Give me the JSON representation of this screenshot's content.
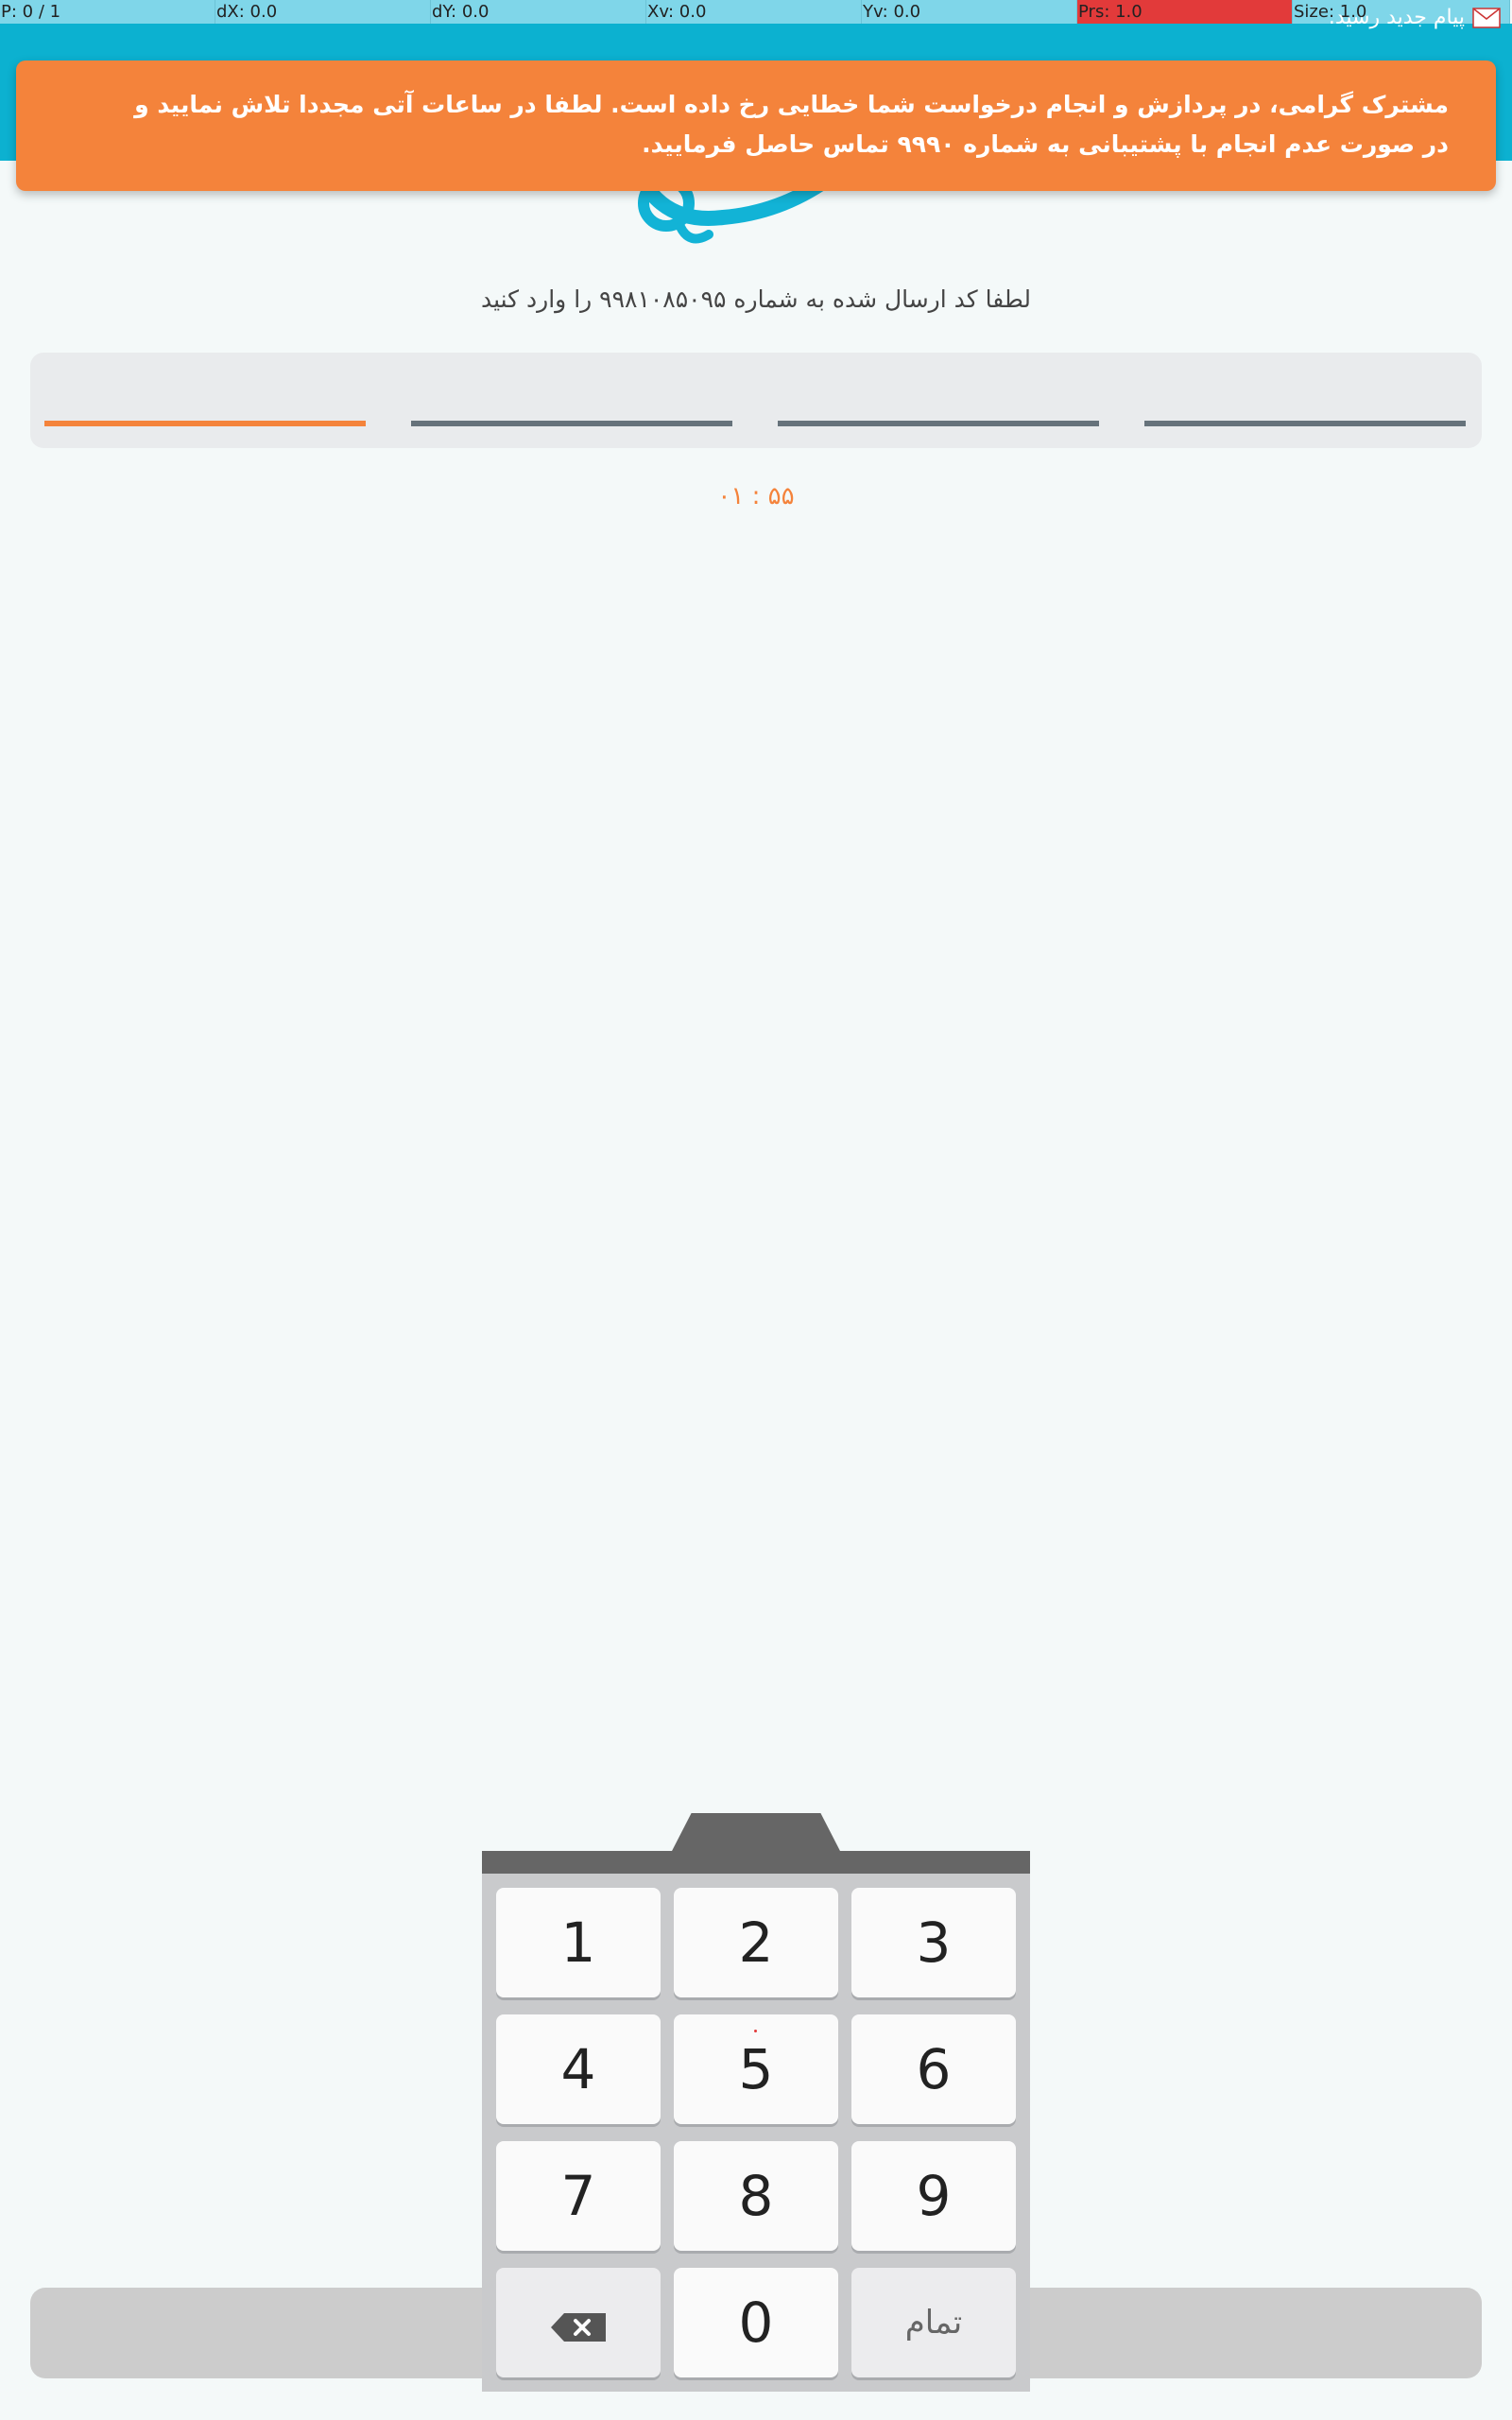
{
  "debug": {
    "p": "P: 0 / 1",
    "dx": "dX: 0.0",
    "dy": "dY: 0.0",
    "xv": "Xv: 0.0",
    "yv": "Yv: 0.0",
    "prs": "Prs: 1.0",
    "size": "Size: 1.0"
  },
  "status": {
    "notification": "پیام  جدید رسید."
  },
  "alert": {
    "message": "مشترک گرامی، در پردازش و انجام درخواست شما خطایی رخ داده است. لطفا در ساعات آتی مجددا تلاش نمایید و در صورت عدم انجام با پشتیبانی به شماره ۹۹۹۰ تماس حاصل فرمایید."
  },
  "instruction": "لطفا کد ارسال شده به شماره ۹۹۸۱۰۸۵۰۹۵ را وارد کنید",
  "code": {
    "digits": [
      "",
      "",
      "",
      ""
    ],
    "active_index": 0
  },
  "timer": "۰۱ : ۵۵",
  "keypad": {
    "keys": [
      "1",
      "2",
      "3",
      "4",
      "5",
      "6",
      "7",
      "8",
      "9",
      "0"
    ],
    "done_label": "تمام",
    "backspace_icon": "backspace-icon"
  },
  "colors": {
    "header": "#0cb1d0",
    "alert": "#f4833b",
    "active_slot": "#f4833b",
    "inactive_slot": "#66727b"
  }
}
